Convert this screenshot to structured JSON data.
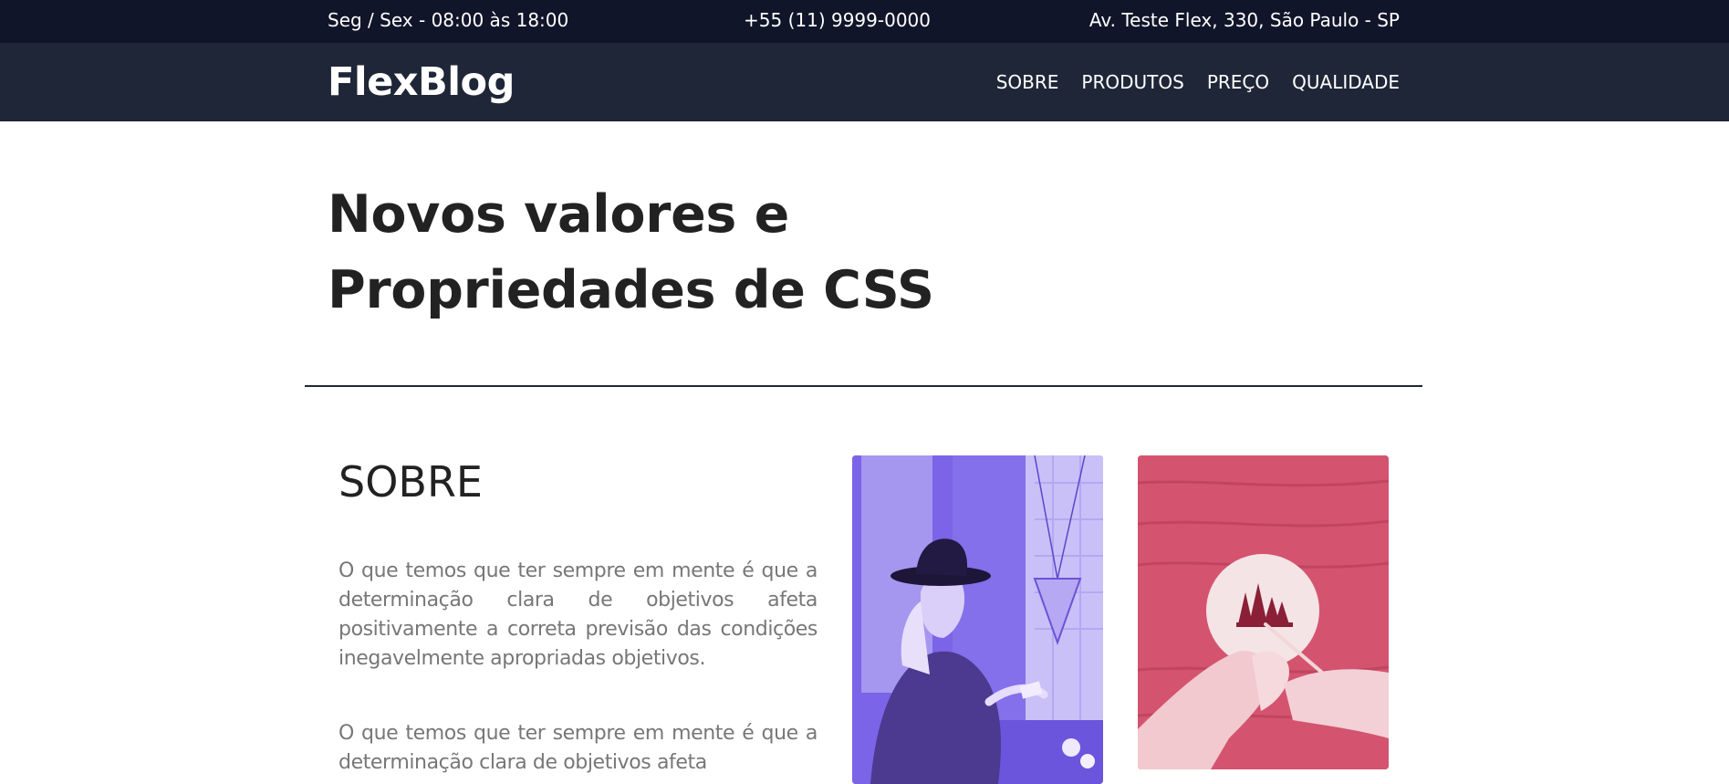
{
  "topbar": {
    "hours": "Seg / Sex - 08:00 às 18:00",
    "phone": "+55 (11) 9999-0000",
    "address": "Av. Teste Flex, 330, São Paulo - SP"
  },
  "header": {
    "logo": "FlexBlog",
    "nav": [
      {
        "label": "SOBRE"
      },
      {
        "label": "PRODUTOS"
      },
      {
        "label": "PREÇO"
      },
      {
        "label": "QUALIDADE"
      }
    ]
  },
  "hero": {
    "title_line1": "Novos valores e",
    "title_line2": "Propriedades de CSS"
  },
  "about": {
    "heading": "SOBRE",
    "paragraphs": [
      "O que temos que ter sempre em mente é que a determinação clara de objetivos afeta positivamente a correta previsão das condições inegavelmente apropriadas objetivos.",
      "O que temos que ter sempre em mente é que a determinação clara de objetivos afeta"
    ]
  },
  "images": [
    {
      "icon": "woman-with-hat-photo",
      "tint": "#7a60e8"
    },
    {
      "icon": "hand-painting-photo",
      "tint": "#d65672"
    }
  ],
  "colors": {
    "topbar_bg": "#11152a",
    "navbar_bg": "#1f2638",
    "heading_text": "#222222",
    "body_text": "#777777"
  }
}
